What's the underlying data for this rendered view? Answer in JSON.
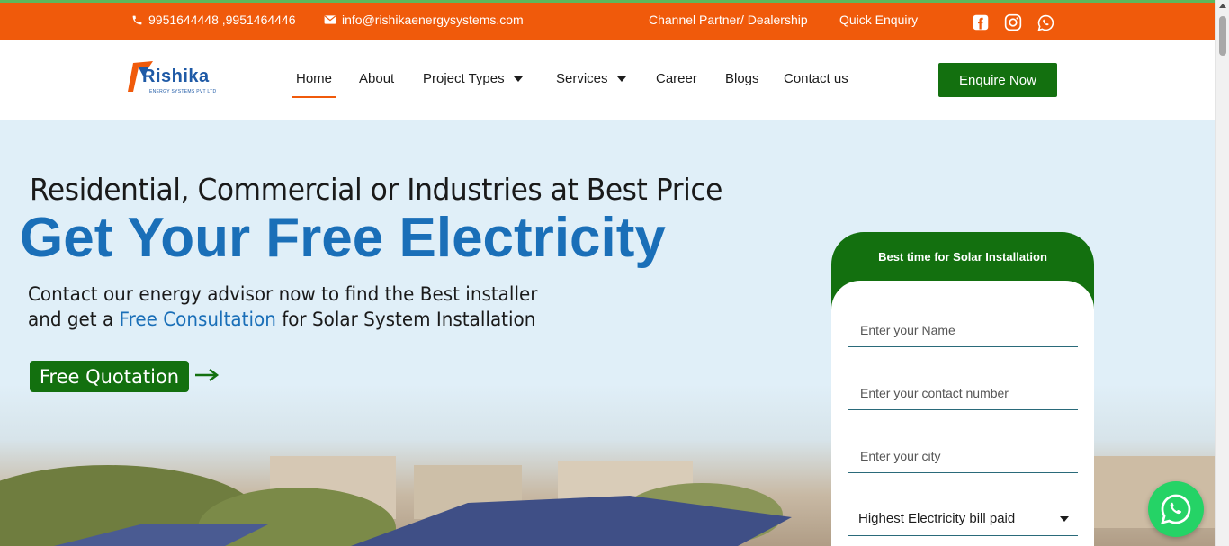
{
  "topbar": {
    "phone": "9951644448 ,9951464446",
    "email": "info@rishikaenergysystems.com",
    "channel_partner": "Channel Partner/ Dealership",
    "quick_enquiry": "Quick Enquiry",
    "social_icons": [
      "facebook-icon",
      "instagram-icon",
      "whatsapp-icon"
    ]
  },
  "brand": {
    "logo_text": "Rishika",
    "logo_sub": "ENERGY SYSTEMS PVT LTD"
  },
  "nav": {
    "items": [
      {
        "label": "Home",
        "active": true,
        "dropdown": false
      },
      {
        "label": "About",
        "active": false,
        "dropdown": false
      },
      {
        "label": "Project Types",
        "active": false,
        "dropdown": true
      },
      {
        "label": "Services",
        "active": false,
        "dropdown": true
      },
      {
        "label": "Career",
        "active": false,
        "dropdown": false
      },
      {
        "label": "Blogs",
        "active": false,
        "dropdown": false
      },
      {
        "label": "Contact us",
        "active": false,
        "dropdown": false
      }
    ],
    "cta": "Enquire Now"
  },
  "hero": {
    "subtitle": "Residential, Commercial or Industries at Best Price",
    "title": "Get Your Free Electricity",
    "desc_line1": "Contact our energy advisor now to find the Best installer",
    "desc_line2_prefix": "and get a ",
    "desc_line2_highlight": "Free Consultation",
    "desc_line2_suffix": " for Solar System Installation",
    "cta": "Free Quotation"
  },
  "form": {
    "title": "Best time for Solar Installation",
    "name_placeholder": "Enter your Name",
    "contact_placeholder": "Enter your contact number",
    "city_placeholder": "Enter your city",
    "bill_select": "Highest Electricity bill paid"
  },
  "colors": {
    "topbar": "#f05a0b",
    "brand_green": "#13700f",
    "brand_blue": "#1a6fb8",
    "whatsapp": "#25d366"
  }
}
